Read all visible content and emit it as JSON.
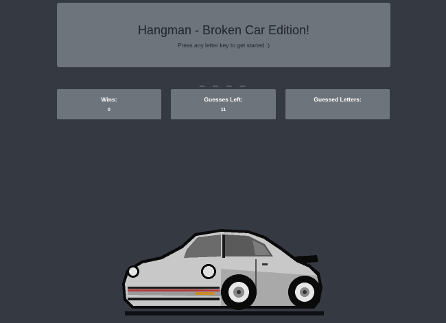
{
  "header": {
    "title": "Hangman - Broken Car Edition!",
    "subtitle": "Press any letter key to get started :)"
  },
  "game": {
    "word_display": "_ _ _ _"
  },
  "stats": {
    "wins_label": "Wins:",
    "wins_value": "0",
    "guesses_left_label": "Guesses Left:",
    "guesses_left_value": "11",
    "guessed_letters_label": "Guessed Letters:",
    "guessed_letters_value": ""
  },
  "illustration": {
    "icon": "pixel-art-sports-car-icon",
    "body_color": "#c8c8c8",
    "window_color": "#6b6b6b",
    "outline_color": "#0a0a0a"
  },
  "colors": {
    "background": "#353a42",
    "card": "#6e747c",
    "title_text": "#1f232a",
    "card_text": "#ffffff"
  }
}
